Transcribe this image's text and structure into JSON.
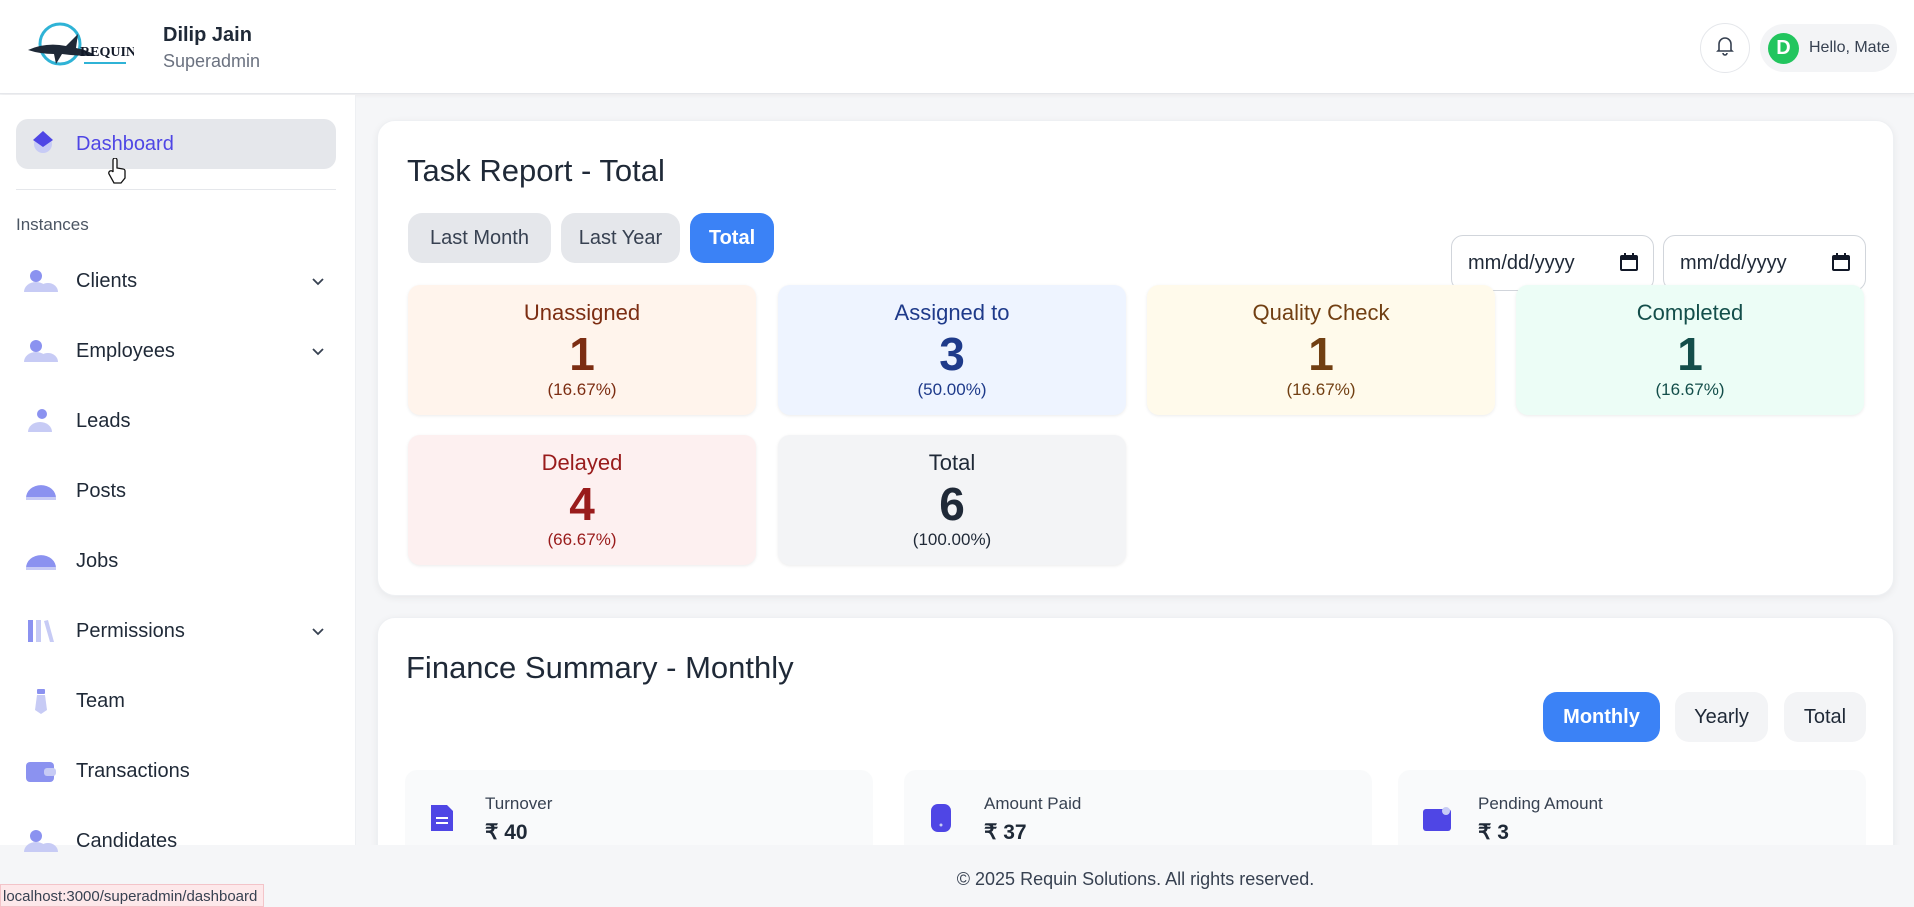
{
  "header": {
    "logo_text": "REQUIN",
    "user_name": "Dilip Jain",
    "user_role": "Superadmin",
    "avatar_letter": "D",
    "greeting": "Hello, Mate"
  },
  "sidebar": {
    "active": {
      "label": "Dashboard",
      "icon": "dashboard-diamond-icon"
    },
    "section_title": "Instances",
    "items": [
      {
        "label": "Clients",
        "icon": "users-icon",
        "has_submenu": true
      },
      {
        "label": "Employees",
        "icon": "users-icon",
        "has_submenu": true
      },
      {
        "label": "Leads",
        "icon": "lead-icon",
        "has_submenu": false
      },
      {
        "label": "Posts",
        "icon": "cloud-icon",
        "has_submenu": false
      },
      {
        "label": "Jobs",
        "icon": "cloud-icon",
        "has_submenu": false
      },
      {
        "label": "Permissions",
        "icon": "library-icon",
        "has_submenu": true
      },
      {
        "label": "Team",
        "icon": "tie-icon",
        "has_submenu": false
      },
      {
        "label": "Transactions",
        "icon": "wallet-icon",
        "has_submenu": false
      },
      {
        "label": "Candidates",
        "icon": "users-icon",
        "has_submenu": false
      }
    ]
  },
  "task_report": {
    "title": "Task Report - Total",
    "filters": [
      "Last Month",
      "Last Year",
      "Total"
    ],
    "active_filter": "Total",
    "date_placeholder_from": "mm/dd/yyyy",
    "date_placeholder_to": "mm/dd/yyyy",
    "stats": [
      {
        "title": "Unassigned",
        "value": "1",
        "pct": "(16.67%)"
      },
      {
        "title": "Assigned to",
        "value": "3",
        "pct": "(50.00%)"
      },
      {
        "title": "Quality Check",
        "value": "1",
        "pct": "(16.67%)"
      },
      {
        "title": "Completed",
        "value": "1",
        "pct": "(16.67%)"
      },
      {
        "title": "Delayed",
        "value": "4",
        "pct": "(66.67%)"
      },
      {
        "title": "Total",
        "value": "6",
        "pct": "(100.00%)"
      }
    ]
  },
  "finance": {
    "title": "Finance Summary - Monthly",
    "filters": [
      "Monthly",
      "Yearly",
      "Total"
    ],
    "active_filter": "Monthly",
    "cards": [
      {
        "label": "Turnover",
        "value": "₹ 40",
        "icon": "document-icon"
      },
      {
        "label": "Amount Paid",
        "value": "₹ 37",
        "icon": "phone-icon"
      },
      {
        "label": "Pending Amount",
        "value": "₹ 3",
        "icon": "wallet-icon"
      }
    ]
  },
  "footer": {
    "text": "© 2025 Requin Solutions. All rights reserved."
  },
  "status_bar": {
    "url": "localhost:3000/superadmin/dashboard"
  },
  "colors": {
    "primary": "#3b82f6",
    "active_nav_text": "#4f46e5",
    "unassigned_bg": "#fff4ec",
    "assigned_bg": "#eef4ff",
    "quality_bg": "#fffaeb",
    "completed_bg": "#ecfdf6",
    "delayed_bg": "#fdf0f0",
    "total_bg": "#f3f4f6"
  }
}
